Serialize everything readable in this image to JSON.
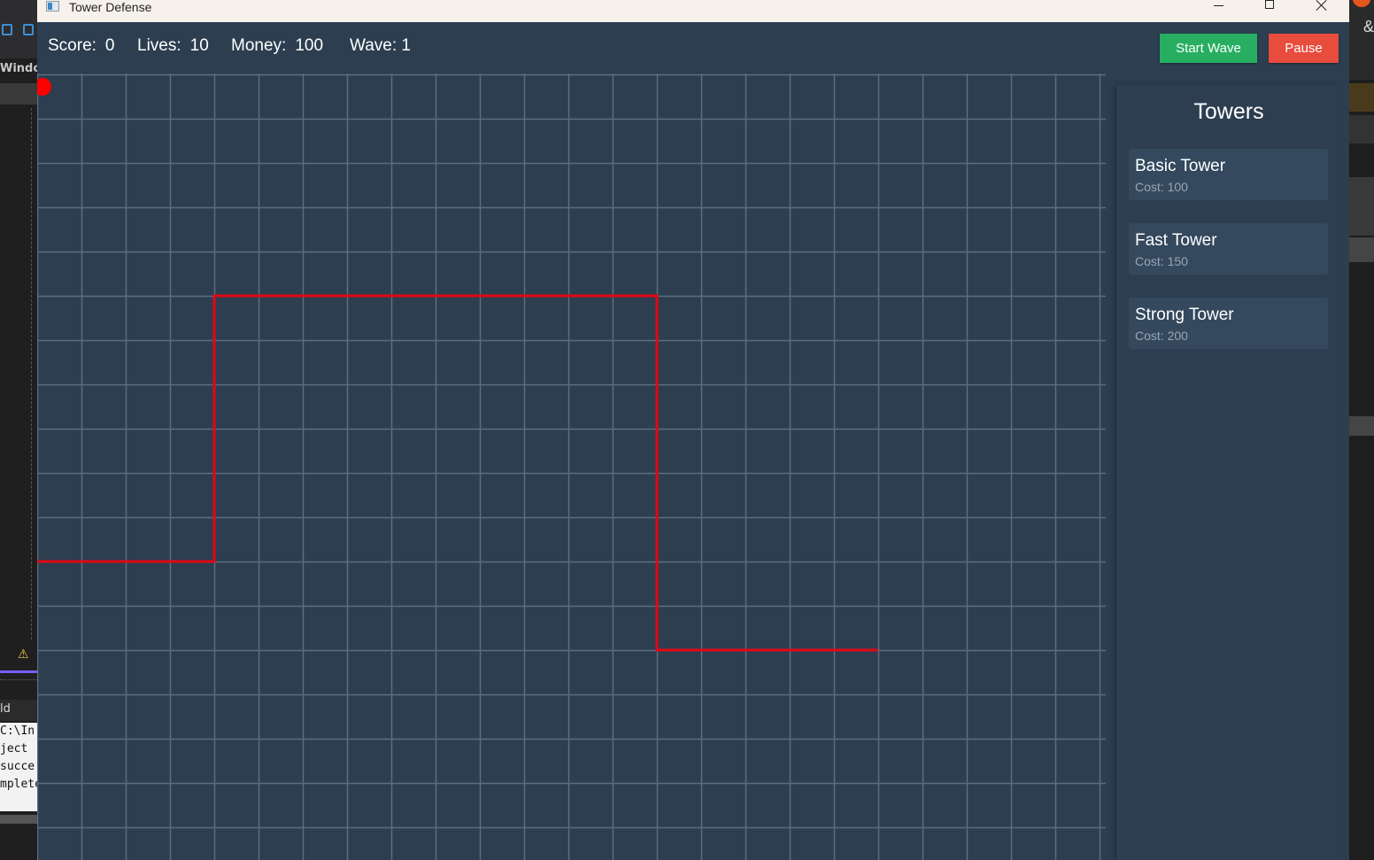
{
  "background": {
    "left_label": "Windo",
    "left_tab": "ld",
    "console_lines": [
      "C:\\In",
      "ject '",
      " succe",
      "mplete"
    ],
    "right_glyph": "&"
  },
  "window": {
    "title": "Tower Defense"
  },
  "hud": {
    "score_label": "Score:",
    "score_value": "0",
    "lives_label": "Lives:",
    "lives_value": "10",
    "money_label": "Money:",
    "money_value": "100",
    "wave_label": "Wave:",
    "wave_value": "1"
  },
  "buttons": {
    "start_wave": "Start Wave",
    "pause": "Pause"
  },
  "towers_panel": {
    "title": "Towers",
    "items": [
      {
        "name": "Basic Tower",
        "cost": "Cost: 100"
      },
      {
        "name": "Fast Tower",
        "cost": "Cost: 150"
      },
      {
        "name": "Strong Tower",
        "cost": "Cost: 200"
      }
    ]
  },
  "colors": {
    "background": "#2c3e50",
    "grid": "#5d6d7e",
    "path": "#e30613",
    "enemy": "#ff0000",
    "start_button": "#27ae60",
    "pause_button": "#e74c3c",
    "card": "#34495e"
  }
}
